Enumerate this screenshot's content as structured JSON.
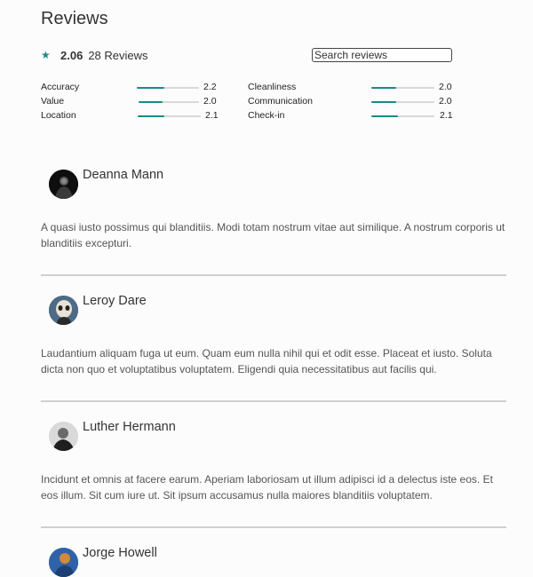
{
  "page": {
    "title": "Reviews",
    "accent_color": "#1a8a86",
    "star_icon": "star-icon"
  },
  "summary": {
    "average": "2.06",
    "count_label": "28 Reviews"
  },
  "search": {
    "placeholder": "Search reviews",
    "value": ""
  },
  "categories": [
    {
      "label": "Accuracy",
      "value": "2.2",
      "fraction": 0.44
    },
    {
      "label": "Value",
      "value": "2.0",
      "fraction": 0.4
    },
    {
      "label": "Location",
      "value": "2.1",
      "fraction": 0.42
    },
    {
      "label": "Cleanliness",
      "value": "2.0",
      "fraction": 0.4
    },
    {
      "label": "Communication",
      "value": "2.0",
      "fraction": 0.4
    },
    {
      "label": "Check-in",
      "value": "2.1",
      "fraction": 0.42
    }
  ],
  "reviews": [
    {
      "name": "Deanna Mann",
      "text": "A quasi iusto possimus qui blanditiis. Modi totam nostrum vitae aut similique. A nostrum corporis ut blanditiis excepturi.",
      "avatar": "avatar-photo"
    },
    {
      "name": "Leroy Dare",
      "text": "Laudantium aliquam fuga ut eum. Quam eum nulla nihil qui et odit esse. Placeat et iusto. Soluta dicta non quo et voluptatibus voluptatem. Eligendi quia necessitatibus aut facilis qui.",
      "avatar": "avatar-photo"
    },
    {
      "name": "Luther Hermann",
      "text": "Incidunt et omnis at facere earum. Aperiam laboriosam ut illum adipisci id a delectus iste eos. Et eos illum. Sit cum iure ut. Sit ipsum accusamus nulla maiores blanditiis voluptatem.",
      "avatar": "avatar-photo"
    },
    {
      "name": "Jorge Howell",
      "text": "",
      "avatar": "avatar-photo"
    }
  ]
}
